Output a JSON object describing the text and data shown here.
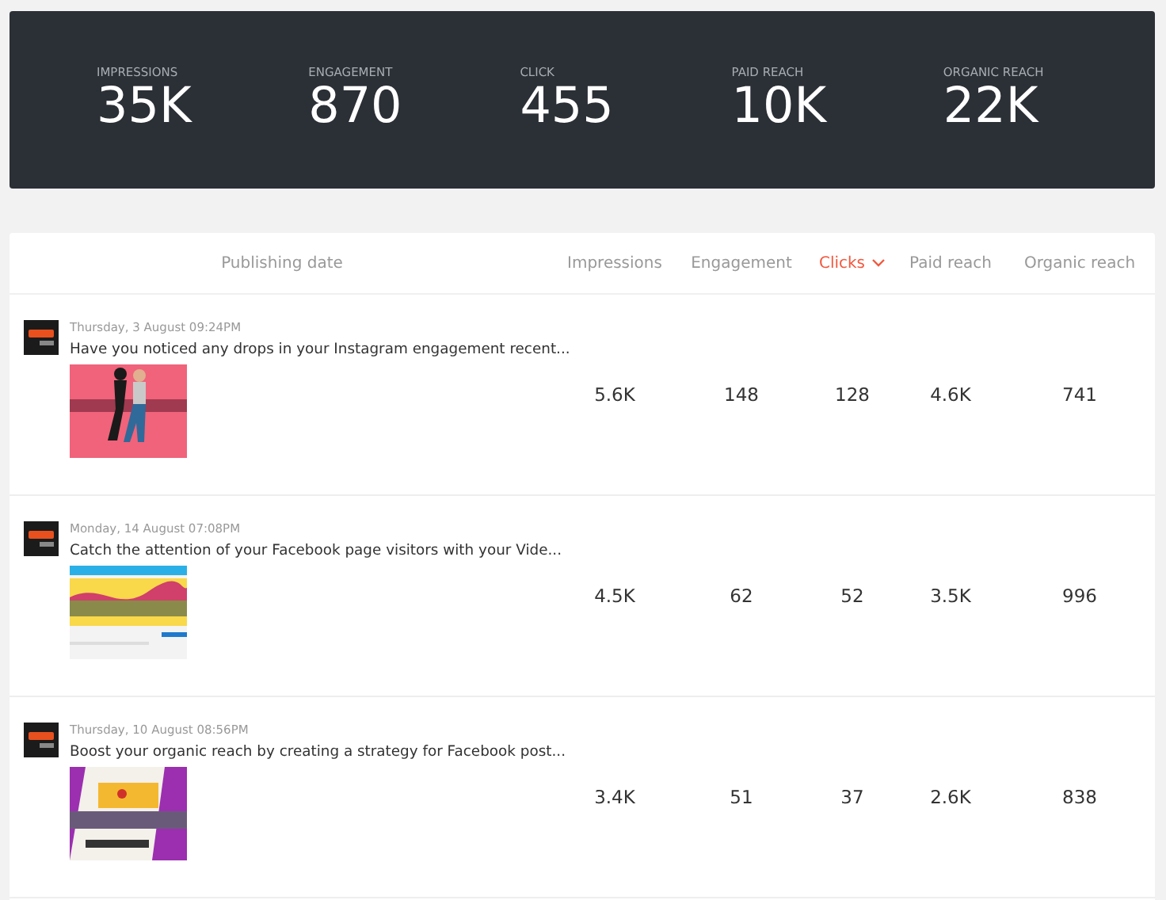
{
  "summary": [
    {
      "label": "IMPRESSIONS",
      "value": "35K"
    },
    {
      "label": "ENGAGEMENT",
      "value": "870"
    },
    {
      "label": "CLICK",
      "value": "455"
    },
    {
      "label": "PAID REACH",
      "value": "10K"
    },
    {
      "label": "ORGANIC REACH",
      "value": "22K"
    }
  ],
  "table": {
    "columns": [
      {
        "label": "Publishing date",
        "selected": false
      },
      {
        "label": "Impressions",
        "selected": false
      },
      {
        "label": "Engagement",
        "selected": false
      },
      {
        "label": "Clicks",
        "selected": true
      },
      {
        "label": "Paid reach",
        "selected": false
      },
      {
        "label": "Organic reach",
        "selected": false
      }
    ],
    "rows": [
      {
        "date": "Thursday, 3 August 09:24PM",
        "title": "Have you noticed any drops in your Instagram engagement recent...",
        "impressions": "5.6K",
        "engagement": "148",
        "clicks": "128",
        "paid_reach": "4.6K",
        "organic_reach": "741"
      },
      {
        "date": "Monday, 14 August 07:08PM",
        "title": "Catch the attention of your Facebook page visitors with your Vide...",
        "impressions": "4.5K",
        "engagement": "62",
        "clicks": "52",
        "paid_reach": "3.5K",
        "organic_reach": "996"
      },
      {
        "date": "Thursday, 10 August 08:56PM",
        "title": "Boost your organic reach by creating a strategy for Facebook post...",
        "impressions": "3.4K",
        "engagement": "51",
        "clicks": "37",
        "paid_reach": "2.6K",
        "organic_reach": "838"
      }
    ]
  }
}
